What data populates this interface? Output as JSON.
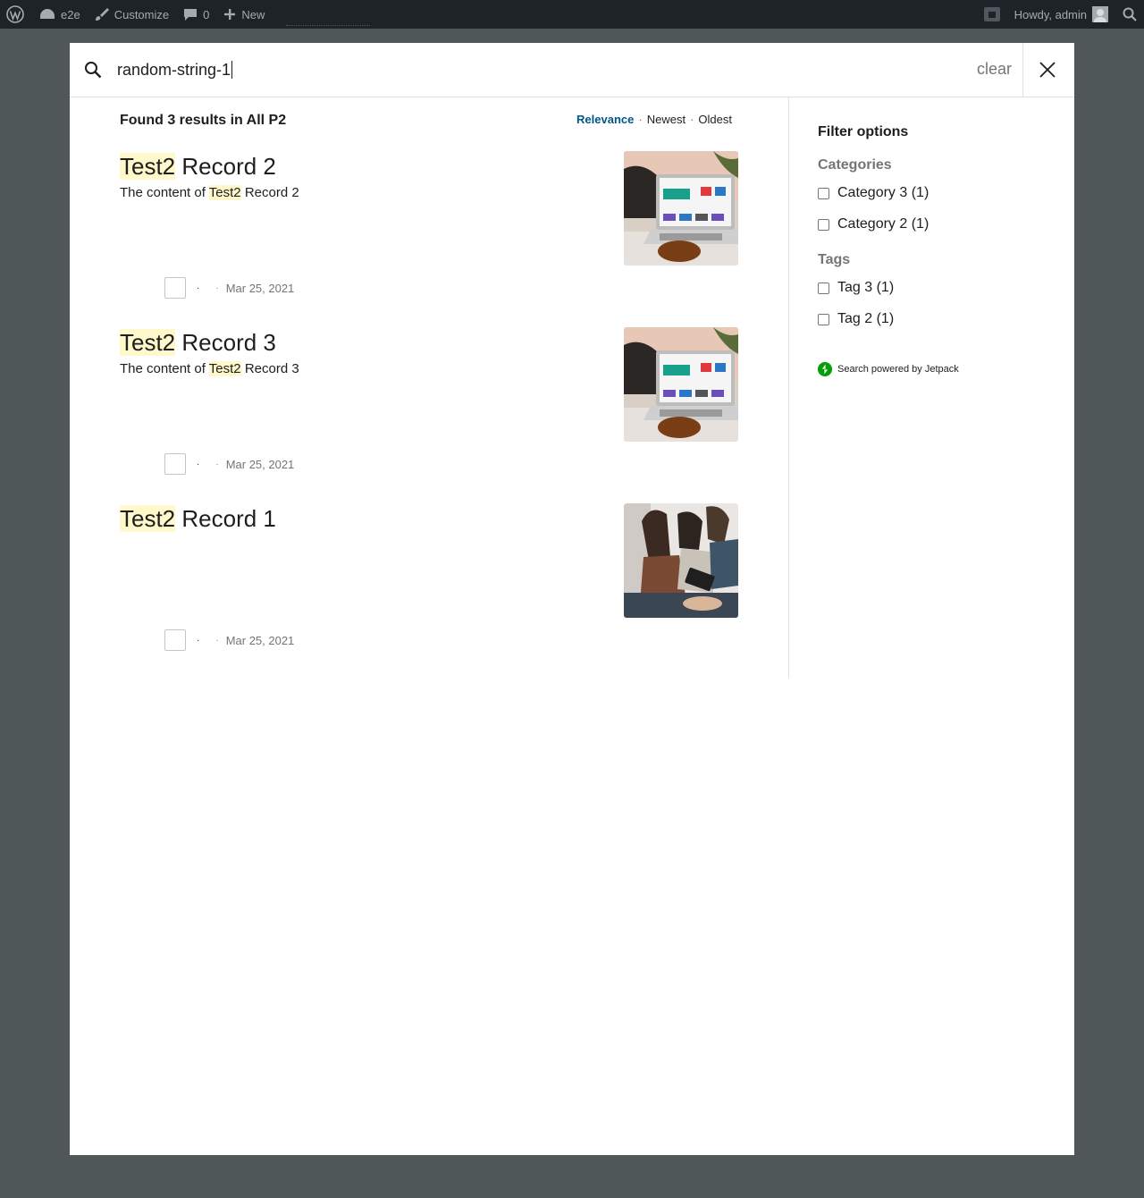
{
  "admin_bar": {
    "site_name": "e2e",
    "customize_label": "Customize",
    "comments_count": "0",
    "new_label": "New",
    "greeting": "Howdy, admin"
  },
  "search": {
    "query": "random-string-1",
    "clear_label": "clear"
  },
  "results": {
    "count_label": "Found 3 results in All P2",
    "sort_options": [
      "Relevance",
      "Newest",
      "Oldest"
    ],
    "sort_active": "Relevance",
    "items": [
      {
        "title_highlight": "Test2",
        "title_rest": " Record 2",
        "excerpt_before": "The content of ",
        "excerpt_highlight": "Test2",
        "excerpt_after": " Record 2",
        "separator_1": "·",
        "separator_2": "·",
        "date": "Mar 25, 2021",
        "thumbnail": "laptop-screen-image"
      },
      {
        "title_highlight": "Test2",
        "title_rest": " Record 3",
        "excerpt_before": "The content of ",
        "excerpt_highlight": "Test2",
        "excerpt_after": " Record 3",
        "separator_1": "·",
        "separator_2": "·",
        "date": "Mar 25, 2021",
        "thumbnail": "laptop-screen-image"
      },
      {
        "title_highlight": "Test2",
        "title_rest": " Record 1",
        "excerpt_before": "",
        "excerpt_highlight": "",
        "excerpt_after": "",
        "separator_1": "·",
        "separator_2": "·",
        "date": "Mar 25, 2021",
        "thumbnail": "people-reading-image"
      }
    ]
  },
  "filters": {
    "heading": "Filter options",
    "categories_title": "Categories",
    "categories": [
      "Category 3 (1)",
      "Category 2 (1)"
    ],
    "tags_title": "Tags",
    "tags": [
      "Tag 3 (1)",
      "Tag 2 (1)"
    ],
    "powered_by": "Search powered by Jetpack"
  },
  "colors": {
    "accent": "#02568a",
    "highlight": "#fef8cb",
    "jetpack_green": "#069e08",
    "admin_bar": "#1d2327",
    "overlay": "#4f5758"
  }
}
